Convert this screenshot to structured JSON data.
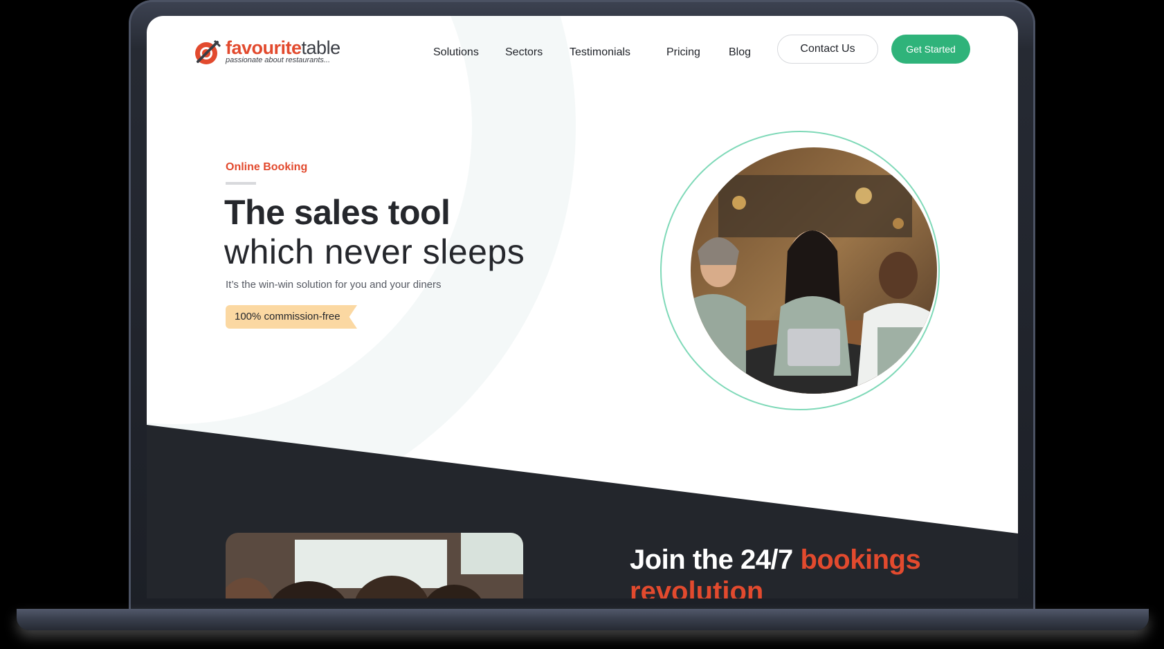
{
  "brand": {
    "name_primary": "favourite",
    "name_secondary": "table",
    "tagline": "passionate about restaurants..."
  },
  "nav": {
    "items": [
      "Solutions",
      "Sectors",
      "Testimonials",
      "Pricing",
      "Blog"
    ],
    "contact_label": "Contact Us",
    "cta_label": "Get Started"
  },
  "hero": {
    "eyebrow": "Online Booking",
    "headline_bold": "The sales tool",
    "headline_light": "which never sleeps",
    "lede": "It’s the win-win solution for you and your diners",
    "badge": "100% commission-free"
  },
  "section2": {
    "heading_white": "Join the 24/7",
    "heading_accent": "bookings",
    "heading_line2": "revolution"
  },
  "colors": {
    "accent": "#e24a2e",
    "cta_green": "#2fb37a",
    "dark_band": "#23262c",
    "badge": "#fbd8a2"
  },
  "icons": {
    "logo": "plate-fork-logo-icon"
  }
}
